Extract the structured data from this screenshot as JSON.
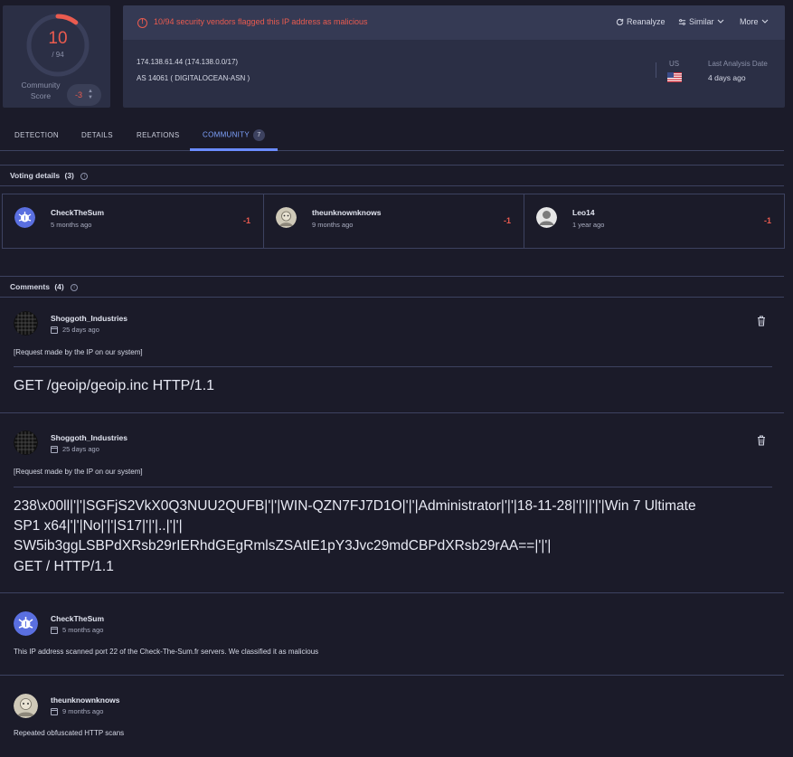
{
  "score": {
    "detections": "10",
    "total": "/ 94",
    "community_label": "Community Score",
    "community_value": "-3",
    "detection_ratio": 0.106
  },
  "header": {
    "alert": "10/94 security vendors flagged this IP address as malicious",
    "reanalyze": "Reanalyze",
    "similar": "Similar",
    "more": "More",
    "ip": "174.138.61.44  (174.138.0.0/17)",
    "as": "AS 14061  ( DIGITALOCEAN-ASN )",
    "country": "US",
    "last_analysis_label": "Last Analysis Date",
    "last_analysis_value": "4 days ago"
  },
  "tabs": [
    {
      "label": "DETECTION"
    },
    {
      "label": "DETAILS"
    },
    {
      "label": "RELATIONS"
    },
    {
      "label": "COMMUNITY",
      "badge": "7"
    }
  ],
  "voting": {
    "title": "Voting details",
    "count": "(3)",
    "votes": [
      {
        "name": "CheckTheSum",
        "time": "5 months ago",
        "value": "-1"
      },
      {
        "name": "theunknownknows",
        "time": "9 months ago",
        "value": "-1"
      },
      {
        "name": "Leo14",
        "time": "1 year ago",
        "value": "-1"
      }
    ]
  },
  "comments_section": {
    "title": "Comments",
    "count": "(4)",
    "comments": [
      {
        "author": "Shoggoth_Industries",
        "time": "25 days ago",
        "note": "[Request made by the IP on our system]",
        "body": [
          "GET /geoip/geoip.inc HTTP/1.1"
        ]
      },
      {
        "author": "Shoggoth_Industries",
        "time": "25 days ago",
        "note": "[Request made by the IP on our system]",
        "body": [
          "238\\x00ll|'|'|SGFjS2VkX0Q3NUU2QUFB|'|'|WIN-QZN7FJ7D1O|'|'|Administrator|'|'|18-11-28|'|'||'|'|Win 7 Ultimate",
          "SP1 x64|'|'|No|'|'|S17|'|'|..|'|'|",
          "SW5ib3ggLSBPdXRsb29rIERhdGEgRmlsZSAtIE1pY3Jvc29mdCBPdXRsb29rAA==|'|'|",
          "GET / HTTP/1.1"
        ]
      },
      {
        "author": "CheckTheSum",
        "time": "5 months ago",
        "note": "This IP address scanned port 22 of the Check-The-Sum.fr servers. We classified it as malicious"
      },
      {
        "author": "theunknownknows",
        "time": "9 months ago",
        "note": "Repeated obfuscated HTTP scans"
      }
    ]
  },
  "colors": {
    "malicious": "#ea5b4f",
    "accent": "#6b8cff",
    "panel": "#2b2f45",
    "background": "#1b1b29"
  }
}
